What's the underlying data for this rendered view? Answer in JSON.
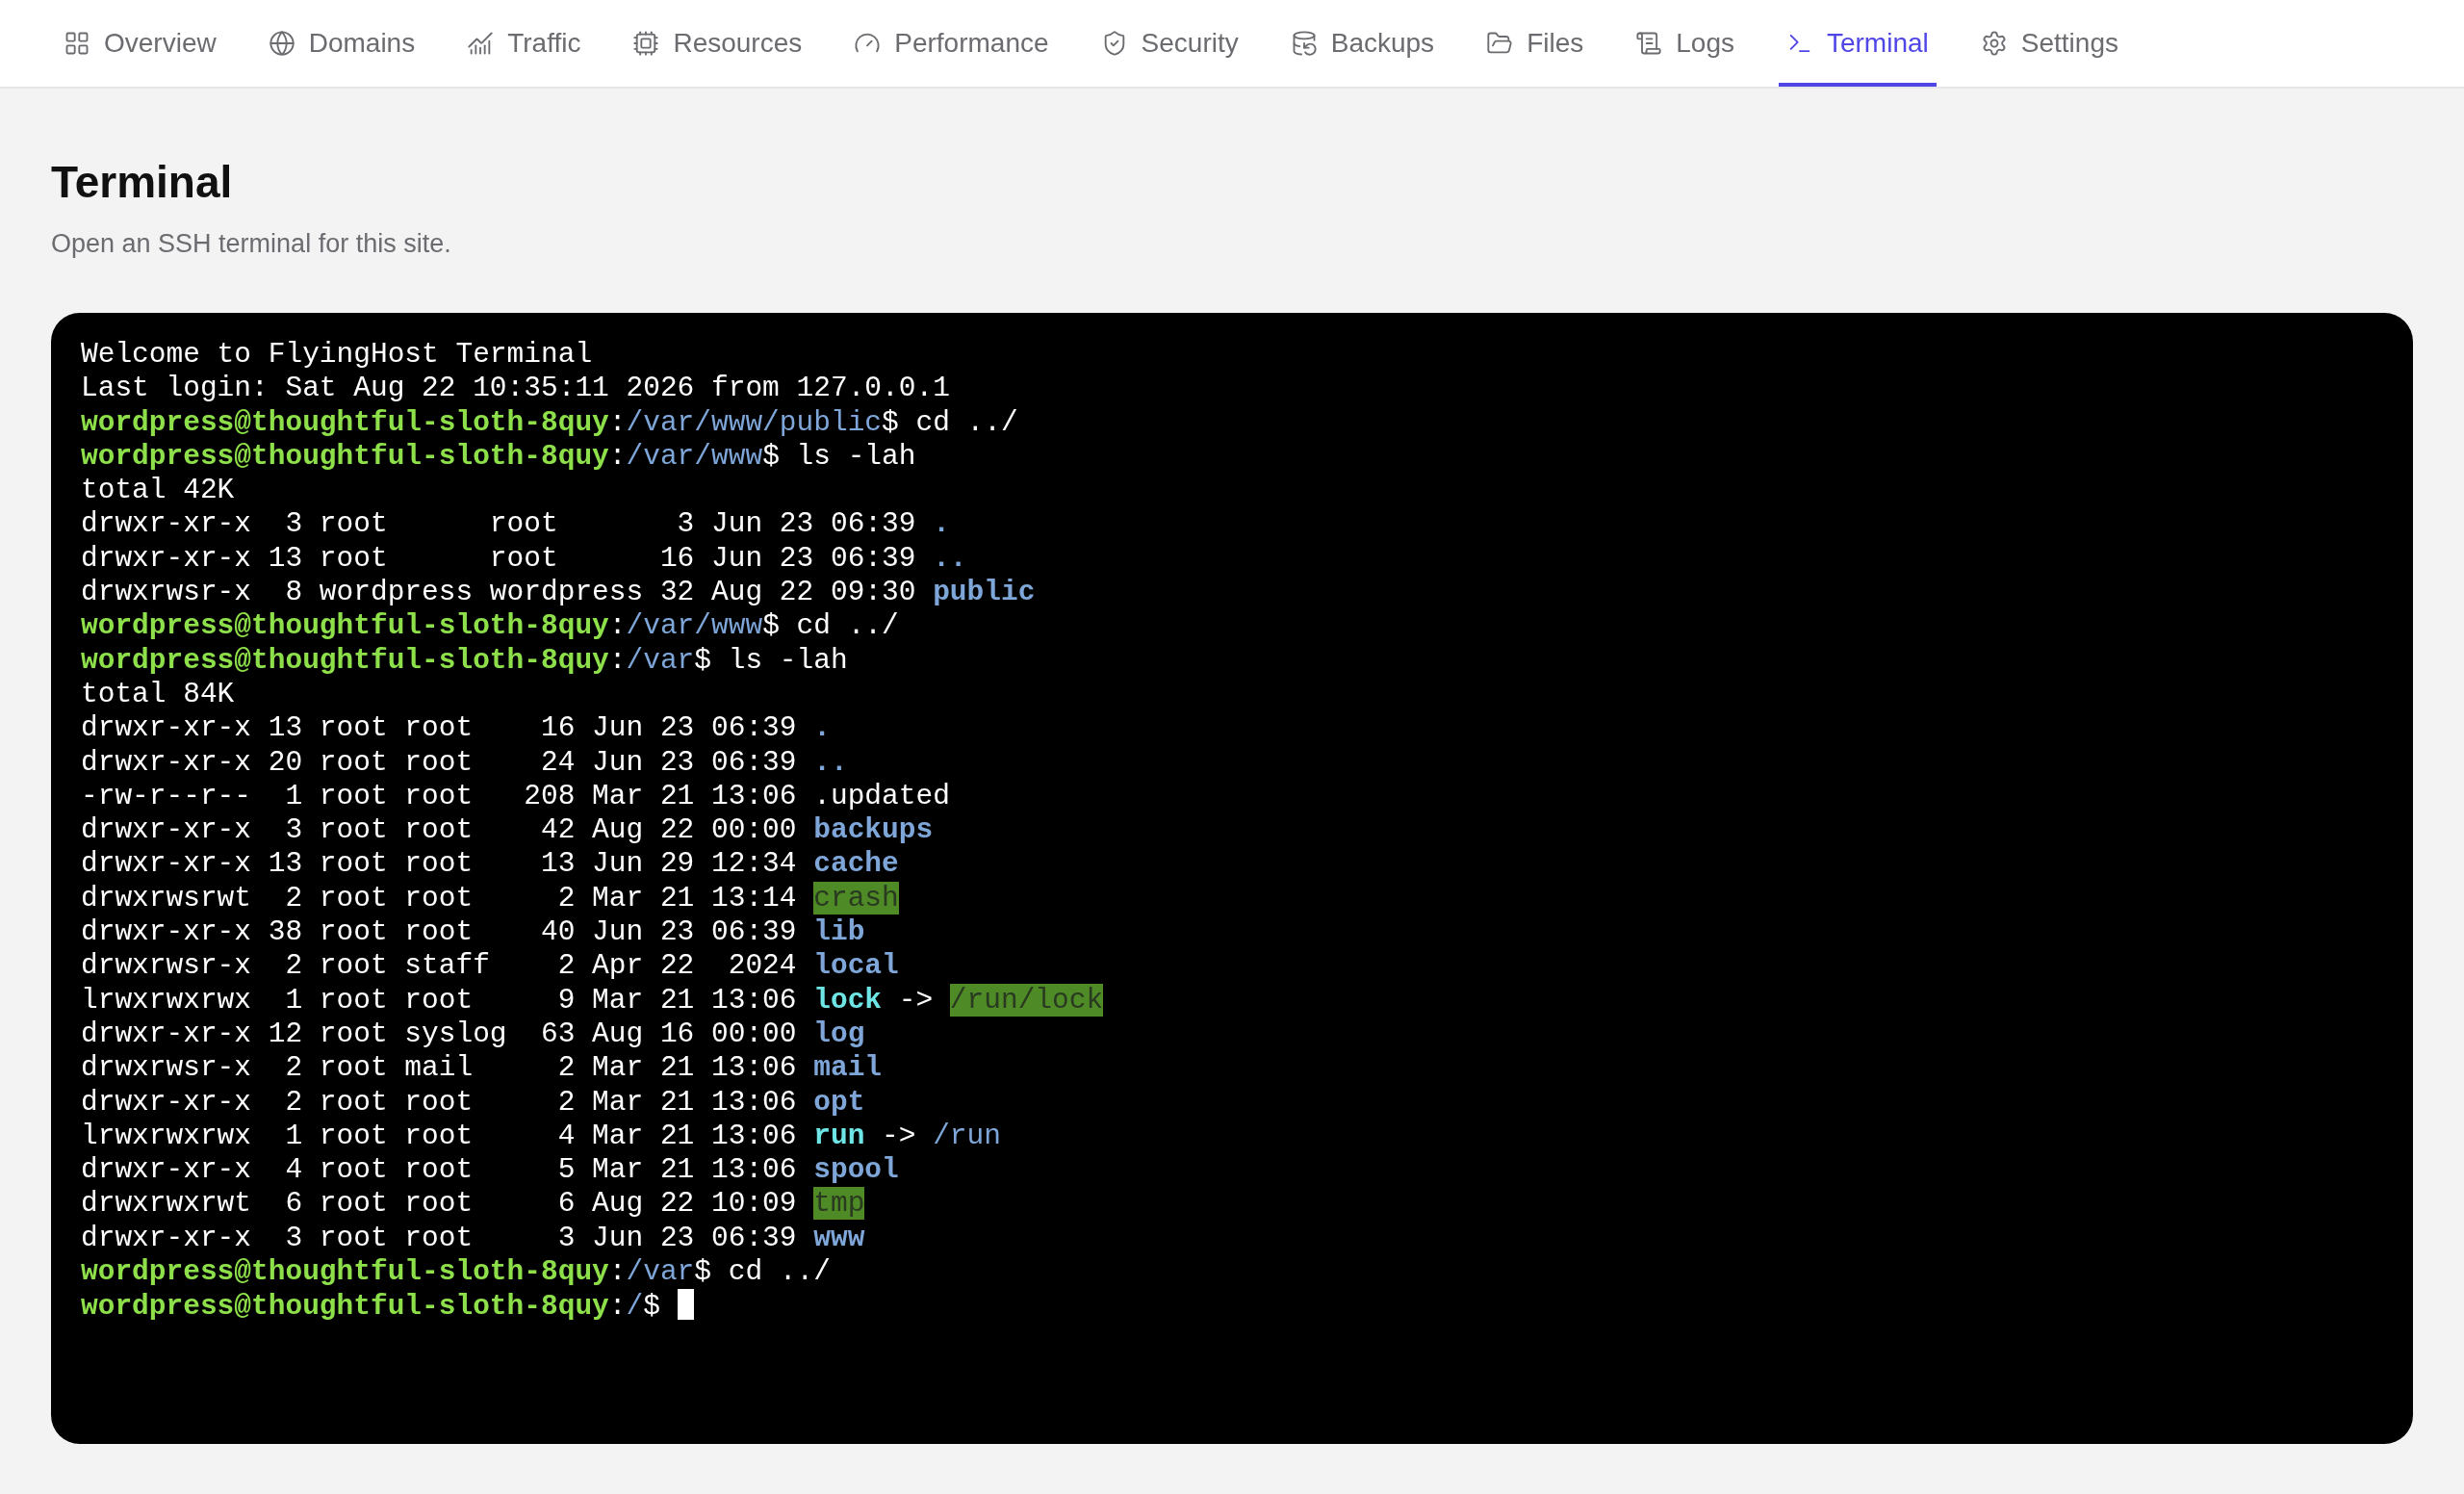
{
  "tabs": [
    {
      "label": "Overview",
      "selected": false
    },
    {
      "label": "Domains",
      "selected": false
    },
    {
      "label": "Traffic",
      "selected": false
    },
    {
      "label": "Resources",
      "selected": false
    },
    {
      "label": "Performance",
      "selected": false
    },
    {
      "label": "Security",
      "selected": false
    },
    {
      "label": "Backups",
      "selected": false
    },
    {
      "label": "Files",
      "selected": false
    },
    {
      "label": "Logs",
      "selected": false
    },
    {
      "label": "Terminal",
      "selected": true
    },
    {
      "label": "Settings",
      "selected": false
    }
  ],
  "page": {
    "title": "Terminal",
    "subtitle": "Open an SSH terminal for this site."
  },
  "terminal": {
    "cursor": true,
    "lines": [
      [
        {
          "kind": "text",
          "text": "Welcome to FlyingHost Terminal"
        }
      ],
      [
        {
          "kind": "text",
          "text": "Last login: Sat Aug 22 10:35:11 2026 from 127.0.0.1"
        }
      ],
      [
        {
          "kind": "user",
          "text": "wordpress@thoughtful-sloth-8quy"
        },
        {
          "kind": "text",
          "text": ":"
        },
        {
          "kind": "path",
          "text": "/var/www/public"
        },
        {
          "kind": "text",
          "text": "$ cd ../"
        }
      ],
      [
        {
          "kind": "user",
          "text": "wordpress@thoughtful-sloth-8quy"
        },
        {
          "kind": "text",
          "text": ":"
        },
        {
          "kind": "path",
          "text": "/var/www"
        },
        {
          "kind": "text",
          "text": "$ ls -lah"
        }
      ],
      [
        {
          "kind": "text",
          "text": "total 42K"
        }
      ],
      [
        {
          "kind": "text",
          "text": "drwxr-xr-x  3 root      root       3 Jun 23 06:39 "
        },
        {
          "kind": "dir",
          "text": "."
        }
      ],
      [
        {
          "kind": "text",
          "text": "drwxr-xr-x 13 root      root      16 Jun 23 06:39 "
        },
        {
          "kind": "dir",
          "text": ".."
        }
      ],
      [
        {
          "kind": "text",
          "text": "drwxrwsr-x  8 wordpress wordpress 32 Aug 22 09:30 "
        },
        {
          "kind": "dir",
          "text": "public"
        }
      ],
      [
        {
          "kind": "user",
          "text": "wordpress@thoughtful-sloth-8quy"
        },
        {
          "kind": "text",
          "text": ":"
        },
        {
          "kind": "path",
          "text": "/var/www"
        },
        {
          "kind": "text",
          "text": "$ cd ../"
        }
      ],
      [
        {
          "kind": "user",
          "text": "wordpress@thoughtful-sloth-8quy"
        },
        {
          "kind": "text",
          "text": ":"
        },
        {
          "kind": "path",
          "text": "/var"
        },
        {
          "kind": "text",
          "text": "$ ls -lah"
        }
      ],
      [
        {
          "kind": "text",
          "text": "total 84K"
        }
      ],
      [
        {
          "kind": "text",
          "text": "drwxr-xr-x 13 root root    16 Jun 23 06:39 "
        },
        {
          "kind": "dir",
          "text": "."
        }
      ],
      [
        {
          "kind": "text",
          "text": "drwxr-xr-x 20 root root    24 Jun 23 06:39 "
        },
        {
          "kind": "dir",
          "text": ".."
        }
      ],
      [
        {
          "kind": "text",
          "text": "-rw-r--r--  1 root root   208 Mar 21 13:06 .updated"
        }
      ],
      [
        {
          "kind": "text",
          "text": "drwxr-xr-x  3 root root    42 Aug 22 00:00 "
        },
        {
          "kind": "dir",
          "text": "backups"
        }
      ],
      [
        {
          "kind": "text",
          "text": "drwxr-xr-x 13 root root    13 Jun 29 12:34 "
        },
        {
          "kind": "dir",
          "text": "cache"
        }
      ],
      [
        {
          "kind": "text",
          "text": "drwxrwsrwt  2 root root     2 Mar 21 13:14 "
        },
        {
          "kind": "sticky",
          "text": "crash"
        }
      ],
      [
        {
          "kind": "text",
          "text": "drwxr-xr-x 38 root root    40 Jun 23 06:39 "
        },
        {
          "kind": "dir",
          "text": "lib"
        }
      ],
      [
        {
          "kind": "text",
          "text": "drwxrwsr-x  2 root staff    2 Apr 22  2024 "
        },
        {
          "kind": "dir",
          "text": "local"
        }
      ],
      [
        {
          "kind": "text",
          "text": "lrwxrwxrwx  1 root root     9 Mar 21 13:06 "
        },
        {
          "kind": "link",
          "text": "lock"
        },
        {
          "kind": "text",
          "text": " -> "
        },
        {
          "kind": "sticky",
          "text": "/run/lock"
        }
      ],
      [
        {
          "kind": "text",
          "text": "drwxr-xr-x 12 root syslog  63 Aug 16 00:00 "
        },
        {
          "kind": "dir",
          "text": "log"
        }
      ],
      [
        {
          "kind": "text",
          "text": "drwxrwsr-x  2 root mail     2 Mar 21 13:06 "
        },
        {
          "kind": "dir",
          "text": "mail"
        }
      ],
      [
        {
          "kind": "text",
          "text": "drwxr-xr-x  2 root root     2 Mar 21 13:06 "
        },
        {
          "kind": "dir",
          "text": "opt"
        }
      ],
      [
        {
          "kind": "text",
          "text": "lrwxrwxrwx  1 root root     4 Mar 21 13:06 "
        },
        {
          "kind": "link",
          "text": "run"
        },
        {
          "kind": "text",
          "text": " -> "
        },
        {
          "kind": "path",
          "text": "/run"
        }
      ],
      [
        {
          "kind": "text",
          "text": "drwxr-xr-x  4 root root     5 Mar 21 13:06 "
        },
        {
          "kind": "dir",
          "text": "spool"
        }
      ],
      [
        {
          "kind": "text",
          "text": "drwxrwxrwt  6 root root     6 Aug 22 10:09 "
        },
        {
          "kind": "sticky",
          "text": "tmp"
        }
      ],
      [
        {
          "kind": "text",
          "text": "drwxr-xr-x  3 root root     3 Jun 23 06:39 "
        },
        {
          "kind": "dir",
          "text": "www"
        }
      ],
      [
        {
          "kind": "user",
          "text": "wordpress@thoughtful-sloth-8quy"
        },
        {
          "kind": "text",
          "text": ":"
        },
        {
          "kind": "path",
          "text": "/var"
        },
        {
          "kind": "text",
          "text": "$ cd ../"
        }
      ],
      [
        {
          "kind": "user",
          "text": "wordpress@thoughtful-sloth-8quy"
        },
        {
          "kind": "text",
          "text": ":"
        },
        {
          "kind": "path",
          "text": "/"
        },
        {
          "kind": "text",
          "text": "$ "
        }
      ]
    ]
  }
}
